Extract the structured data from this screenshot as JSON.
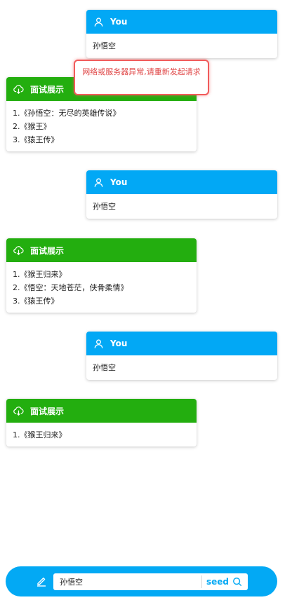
{
  "error_toast": {
    "message": "网络或服务器异常,请重新发起请求"
  },
  "colors": {
    "user_header": "#02a8f5",
    "bot_header": "#23ae0f",
    "bottom_bar": "#03a9f4",
    "error": "#e04848"
  },
  "conversation": [
    {
      "role": "user",
      "header": "You",
      "icon": "user-icon",
      "text": "孙悟空"
    },
    {
      "role": "bot",
      "header": "面试展示",
      "icon": "cloud-download-icon",
      "lines": [
        "1.《孙悟空：无尽的英雄传说》",
        "2.《猴王》",
        "3.《猿王传》"
      ]
    },
    {
      "role": "user",
      "header": "You",
      "icon": "user-icon",
      "text": "孙悟空"
    },
    {
      "role": "bot",
      "header": "面试展示",
      "icon": "cloud-download-icon",
      "lines": [
        "1.《猴王归来》",
        "2.《悟空：天地苍茫，侠骨柔情》",
        "3.《猿王传》"
      ]
    },
    {
      "role": "user",
      "header": "You",
      "icon": "user-icon",
      "text": "孙悟空"
    },
    {
      "role": "bot",
      "header": "面试展示",
      "icon": "cloud-download-icon",
      "lines": [
        "1.《猴王归来》"
      ]
    }
  ],
  "input_bar": {
    "edit_icon": "edit-icon",
    "value": "孙悟空",
    "button_label": "seed",
    "button_icon": "search-icon"
  }
}
